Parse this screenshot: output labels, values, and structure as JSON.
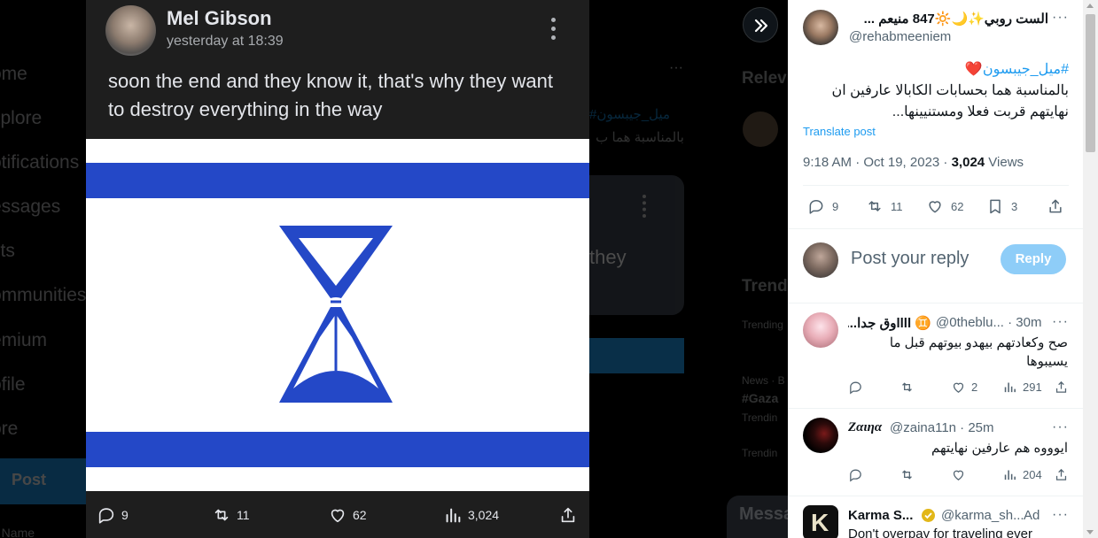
{
  "left_nav": {
    "items": [
      "ome",
      "xplore",
      "otifications",
      "essages",
      "sts",
      "ommunities",
      "emium",
      "ofile",
      "ore"
    ],
    "post_label": "Post",
    "bottom_partial": "1 Name"
  },
  "viewer": {
    "author": "Mel Gibson",
    "time": "yesterday at 18:39",
    "text": "soon the end and they know it, that's why they want to destroy everything in the way",
    "stats": {
      "replies": "9",
      "reposts": "11",
      "likes": "62",
      "views": "3,024"
    }
  },
  "background": {
    "relevant_partial": "Relev",
    "trends_partial": "Trend",
    "hashtag_partial": "#ميل_جيبسون",
    "ar_partial": "بالمناسبة هما ب",
    "they_partial": "they",
    "trending1": "Trending",
    "news": "News · B",
    "gaza": "#Gaza",
    "trending2": "Trendin",
    "trending3": "Trendin",
    "messages_partial": "Messa"
  },
  "panel": {
    "main": {
      "name": "الست روبي✨🌙🔆847 منيعم ...",
      "handle": "@rehabmeeniem",
      "hashtag": "#ميل_جيبسون",
      "heart": "❤️",
      "text_line1": "بالمناسبة هما بحسابات الكابالا عارفين ان",
      "text_line2": "نهايتهم قربت فعلا ومستنيينها...",
      "translate": "Translate post",
      "timestamp": "9:18 AM · Oct 19, 2023 · ",
      "views_count": "3,024",
      "views_label": " Views",
      "replies": "9",
      "reposts": "11",
      "likes": "62",
      "bookmarks": "3"
    },
    "reply_box": {
      "placeholder": "Post your reply",
      "button": "Reply"
    },
    "replies": [
      {
        "name": "♊ llllوق جدا...",
        "handle": "@0theblu... · 30m",
        "line1": "صح وكعادتهم بيهدو بيوتهم قبل ما",
        "line2": "يسيبوها",
        "likes": "2",
        "views": "291"
      },
      {
        "name": "Zαιηα",
        "handle": "@zaina11n · 25m",
        "line1": "ايوووه هم عارفين نهايتهم",
        "views": "204"
      },
      {
        "name": "Karma S...",
        "handle": "@karma_sh...",
        "ad": "Ad",
        "line1": "Don't overpay for traveling ever"
      }
    ]
  },
  "colors": {
    "flag_blue": "#2448c7",
    "link_blue": "#1d9bf0",
    "reply_button": "#8ecdf8"
  }
}
